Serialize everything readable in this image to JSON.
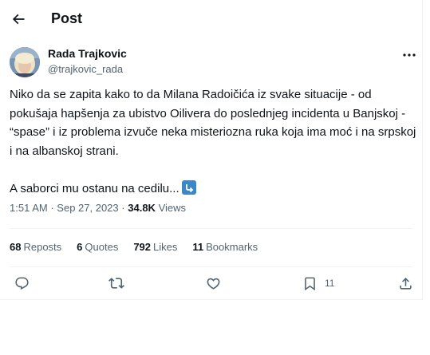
{
  "topbar": {
    "title": "Post"
  },
  "author": {
    "name": "Rada Trajkovic",
    "handle": "@trajkovic_rada"
  },
  "tweet": {
    "paragraphs": [
      "Niko da se zapita kako to da Milana Radoičića iz svake situacije - od pokušaja hapšenja za ubistvo Oilivera do poslednjeg incidenta u Banjskoj - “spase” i iz problema izvuče neka misteriozna ruka koja ima moć i na srpskoj i na albanskoj strani.",
      "A saborci mu ostanu na cedilu..."
    ],
    "emoji": "arrow-right-hook-emoji"
  },
  "meta": {
    "time": "1:51 AM",
    "separator": "·",
    "date": "Sep 27, 2023",
    "views_count": "34.8K",
    "views_label": "Views"
  },
  "stats": [
    {
      "count": "68",
      "label": "Reposts"
    },
    {
      "count": "6",
      "label": "Quotes"
    },
    {
      "count": "792",
      "label": "Likes"
    },
    {
      "count": "11",
      "label": "Bookmarks"
    }
  ],
  "actions": {
    "reply_icon": "reply-icon",
    "repost_icon": "repost-icon",
    "like_icon": "like-icon",
    "bookmark_icon": "bookmark-icon",
    "bookmark_count": "11",
    "share_icon": "share-icon"
  },
  "colors": {
    "text": "#0f1419",
    "secondary": "#536471",
    "border": "#eff3f4",
    "emoji_blue": "#3b88c3"
  }
}
